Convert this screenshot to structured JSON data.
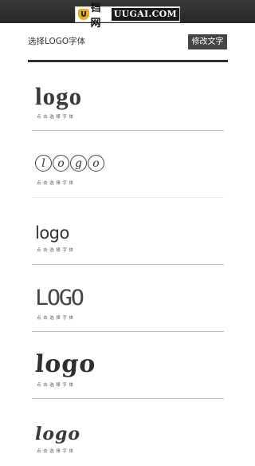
{
  "banner": {
    "brand_cn": "铛网",
    "brand_en": "UUGAI.COM",
    "icon": "shield-logo-icon"
  },
  "header": {
    "title": "选择LOGO字体",
    "modify_button": "修改文字"
  },
  "fonts": [
    {
      "sample": "logo",
      "hint": "点击选择字体"
    },
    {
      "letters": [
        "l",
        "o",
        "g",
        "o"
      ],
      "hint": "点击选择字体"
    },
    {
      "sample": "logo",
      "hint": "点击选择字体"
    },
    {
      "sample": "LOGO",
      "hint": "点击选择字体"
    },
    {
      "sample": "logo",
      "hint": "点击选择字体"
    },
    {
      "sample": "logo",
      "hint": "点击选择字体"
    }
  ]
}
